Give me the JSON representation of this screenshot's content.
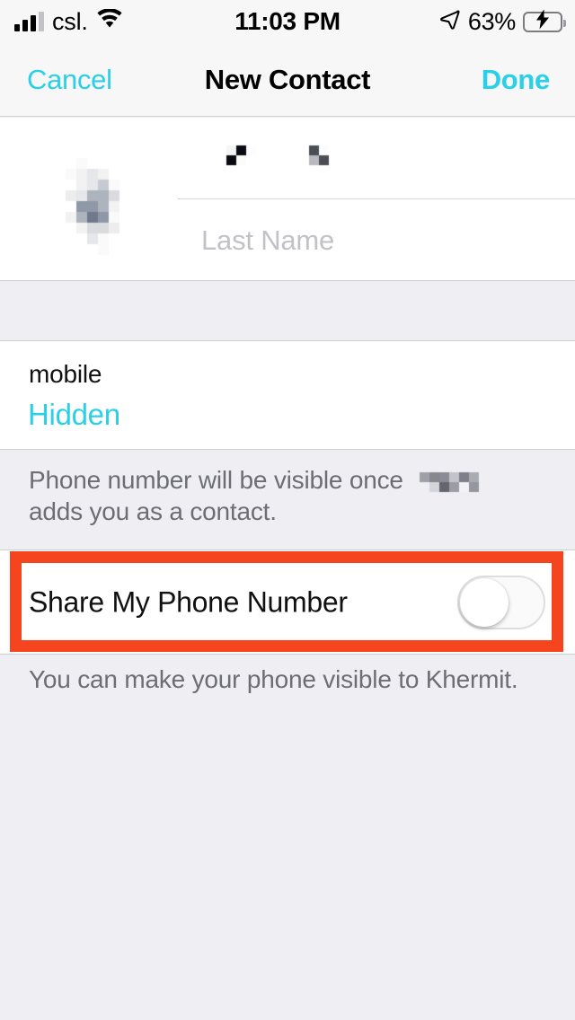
{
  "status_bar": {
    "carrier": "csl.",
    "time": "11:03 PM",
    "battery_percent": "63%",
    "battery_level": 63,
    "charging": true,
    "signal_bars_filled": 3,
    "signal_bars_total": 4,
    "wifi": true,
    "location_arrow": true
  },
  "nav": {
    "cancel_label": "Cancel",
    "title": "New Contact",
    "done_label": "Done"
  },
  "name_section": {
    "first_name_value": "",
    "first_name_redacted": true,
    "last_name_placeholder": "Last Name",
    "last_name_value": "",
    "avatar_redacted": true
  },
  "phone_section": {
    "label": "mobile",
    "value": "Hidden"
  },
  "note_phone_visibility": {
    "line1": "Phone number will be visible once",
    "line2": "adds you as a contact.",
    "name_redacted": true
  },
  "share_row": {
    "label": "Share My Phone Number",
    "toggle_on": false
  },
  "note_share": {
    "text": "You can make your phone visible to Khermit."
  },
  "annotation": {
    "highlight_color": "#F4451E",
    "target": "share-my-phone-number-row"
  },
  "colors": {
    "accent": "#2ACFE8",
    "background": "#EFEEF3",
    "card": "#FFFFFF",
    "separator": "#CFCFD2",
    "secondary_text": "#6D6D74",
    "battery_green": "#36C94B"
  }
}
